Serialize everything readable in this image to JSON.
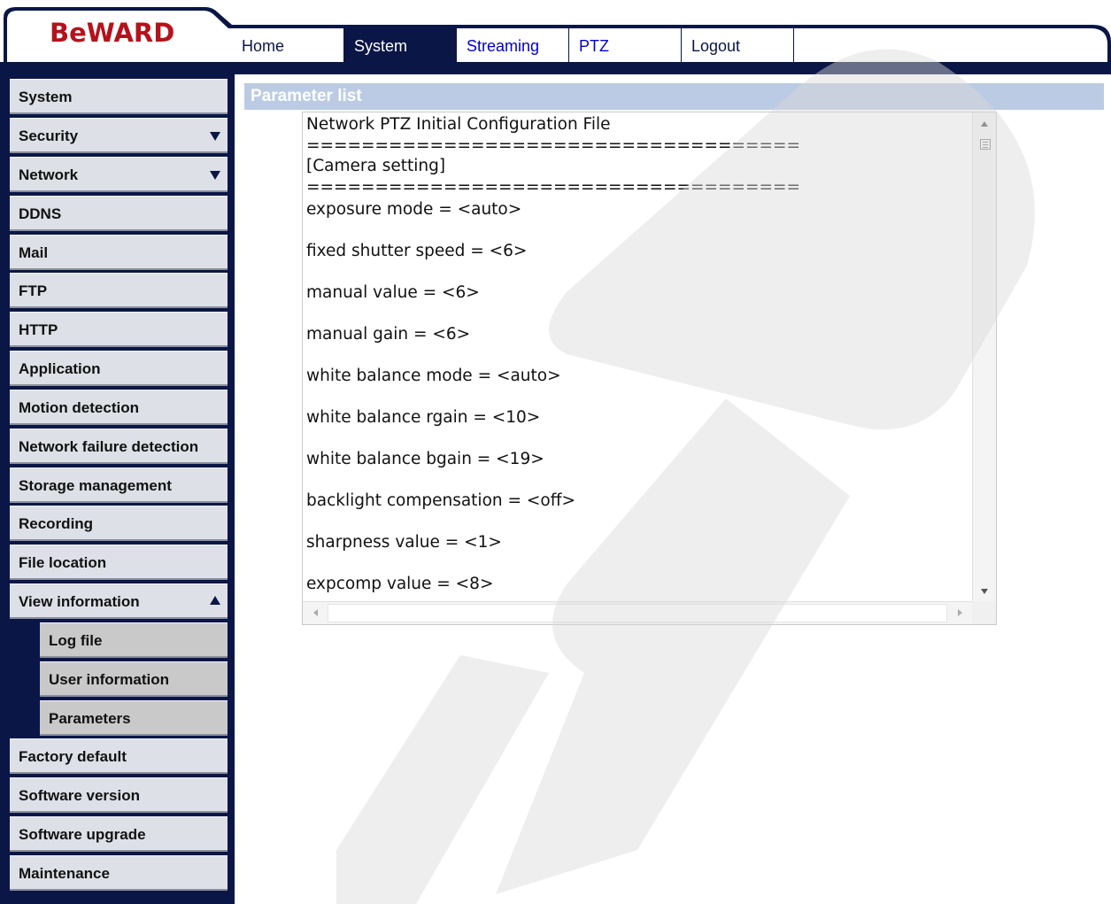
{
  "brand": {
    "logo_text": "BeWARD",
    "logo_color": "#b5121b"
  },
  "colors": {
    "navy": "#0a1646",
    "link_blue": "#0000cc",
    "section_header_bg": "#bccbe4",
    "nav_bg": "#dde0e6",
    "subnav_bg": "#c9c9c9"
  },
  "tabs": [
    {
      "label": "Home",
      "active": false
    },
    {
      "label": "System",
      "active": true
    },
    {
      "label": "Streaming",
      "active": false
    },
    {
      "label": "PTZ",
      "active": false
    },
    {
      "label": "Logout",
      "active": false
    }
  ],
  "sidebar": {
    "items": [
      {
        "label": "System"
      },
      {
        "label": "Security",
        "arrow": "down"
      },
      {
        "label": "Network",
        "arrow": "down"
      },
      {
        "label": "DDNS"
      },
      {
        "label": "Mail"
      },
      {
        "label": "FTP"
      },
      {
        "label": "HTTP"
      },
      {
        "label": "Application"
      },
      {
        "label": "Motion detection"
      },
      {
        "label": "Network failure detection"
      },
      {
        "label": "Storage management"
      },
      {
        "label": "Recording"
      },
      {
        "label": "File location"
      },
      {
        "label": "View information",
        "arrow": "up"
      }
    ],
    "sub_items": [
      {
        "label": "Log file"
      },
      {
        "label": "User information"
      },
      {
        "label": "Parameters"
      }
    ],
    "bottom_items": [
      {
        "label": "Factory default"
      },
      {
        "label": "Software version"
      },
      {
        "label": "Software upgrade"
      },
      {
        "label": "Maintenance"
      }
    ]
  },
  "main": {
    "section_title": "Parameter list",
    "parameter_text": [
      "Network PTZ Initial Configuration File",
      "====================================",
      "[Camera setting]",
      "====================================",
      "exposure mode = <auto>",
      "fixed shutter speed = <6>",
      "manual value = <6>",
      "manual gain = <6>",
      "white balance mode = <auto>",
      "white balance rgain = <10>",
      "white balance bgain = <19>",
      "backlight compensation = <off>",
      "sharpness value = <1>",
      "expcomp value = <8>"
    ]
  }
}
